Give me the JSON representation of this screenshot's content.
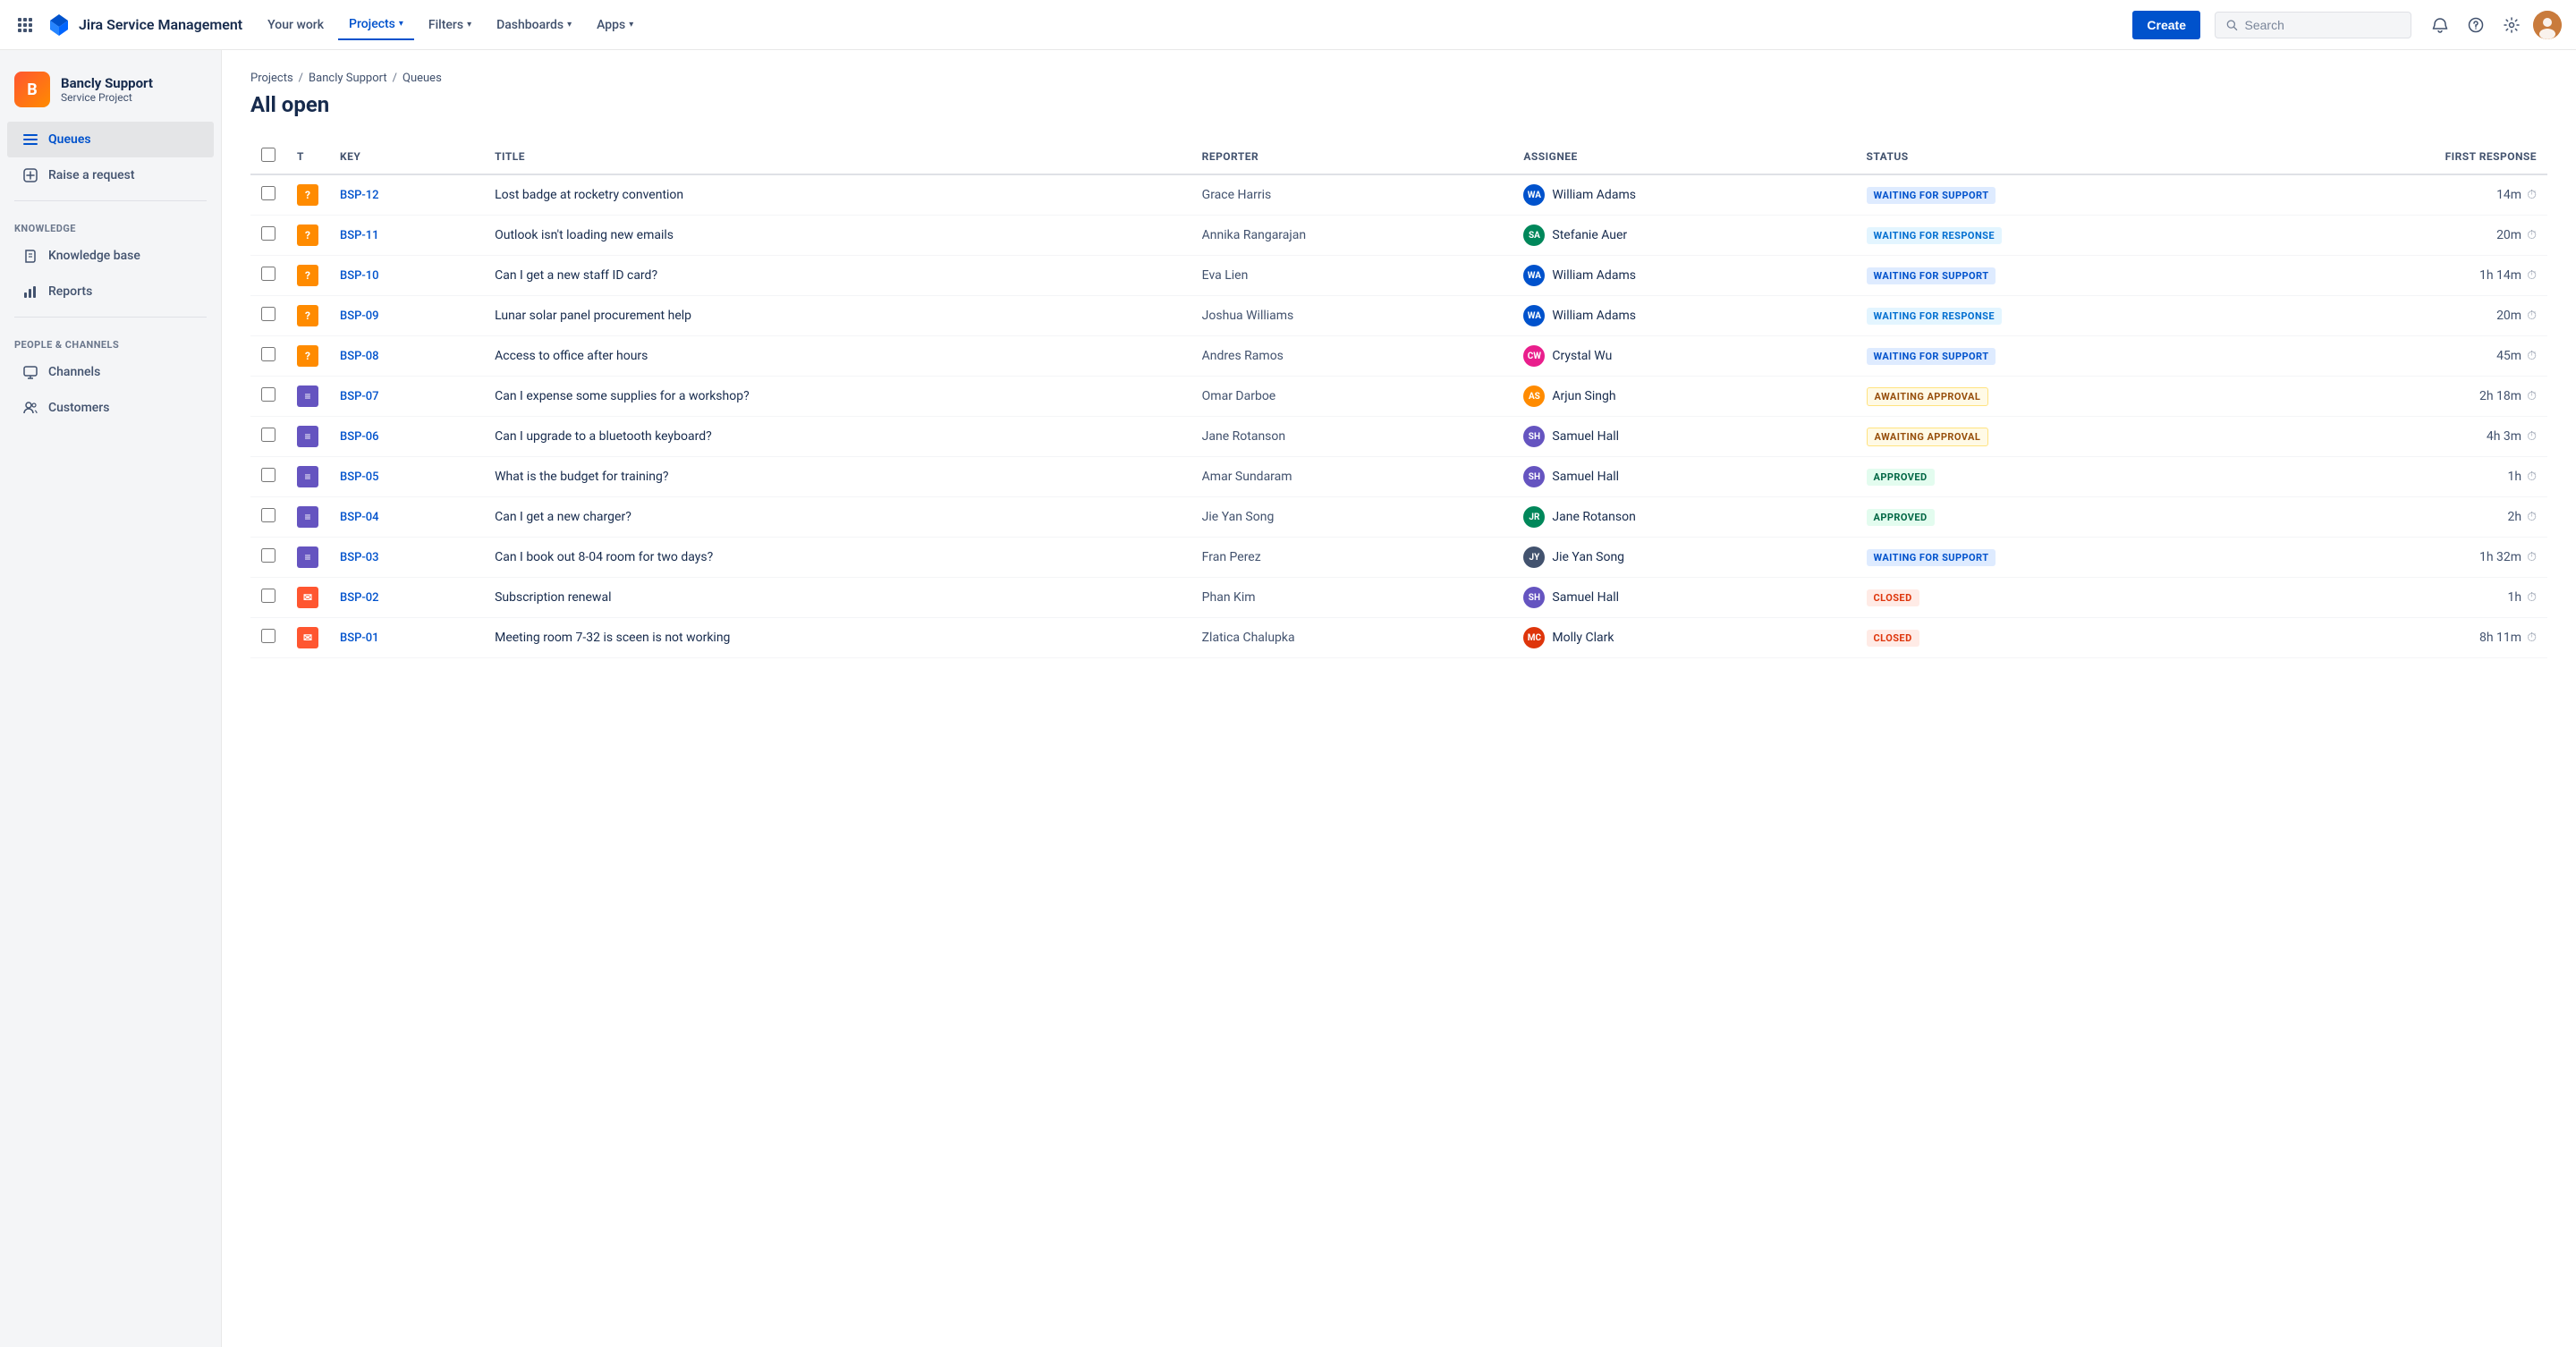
{
  "topnav": {
    "logo_text": "Jira Service Management",
    "nav_items": [
      {
        "label": "Your work",
        "active": false
      },
      {
        "label": "Projects",
        "has_chevron": true,
        "active": true
      },
      {
        "label": "Filters",
        "has_chevron": true,
        "active": false
      },
      {
        "label": "Dashboards",
        "has_chevron": true,
        "active": false
      },
      {
        "label": "Apps",
        "has_chevron": true,
        "active": false
      }
    ],
    "create_label": "Create",
    "search_placeholder": "Search"
  },
  "sidebar": {
    "project_name": "Bancly Support",
    "project_type": "Service Project",
    "main_items": [
      {
        "label": "Queues",
        "active": true,
        "icon": "list"
      },
      {
        "label": "Raise a request",
        "active": false,
        "icon": "plus-circle"
      }
    ],
    "knowledge_label": "KNOWLEDGE",
    "knowledge_items": [
      {
        "label": "Knowledge base",
        "icon": "book"
      },
      {
        "label": "Reports",
        "icon": "bar-chart"
      }
    ],
    "people_label": "PEOPLE & CHANNELS",
    "people_items": [
      {
        "label": "Channels",
        "icon": "monitor"
      },
      {
        "label": "Customers",
        "icon": "users"
      }
    ]
  },
  "breadcrumb": {
    "items": [
      "Projects",
      "Bancly Support",
      "Queues"
    ]
  },
  "page": {
    "title": "All open"
  },
  "table": {
    "columns": [
      "",
      "T",
      "Key",
      "Title",
      "Reporter",
      "Assignee",
      "Status",
      "First response"
    ],
    "rows": [
      {
        "key": "BSP-12",
        "type": "question",
        "title": "Lost badge at rocketry convention",
        "reporter": "Grace Harris",
        "assignee": "William Adams",
        "assignee_initials": "WA",
        "assignee_color": "av-blue",
        "status": "WAITING FOR SUPPORT",
        "status_class": "status-waiting-support",
        "first_response": "14m"
      },
      {
        "key": "BSP-11",
        "type": "question",
        "title": "Outlook isn't loading new emails",
        "reporter": "Annika Rangarajan",
        "assignee": "Stefanie Auer",
        "assignee_initials": "SA",
        "assignee_color": "av-teal",
        "status": "WAITING FOR RESPONSE",
        "status_class": "status-waiting-response",
        "first_response": "20m"
      },
      {
        "key": "BSP-10",
        "type": "question",
        "title": "Can I get a new staff ID card?",
        "reporter": "Eva Lien",
        "assignee": "William Adams",
        "assignee_initials": "WA",
        "assignee_color": "av-blue",
        "status": "WAITING FOR SUPPORT",
        "status_class": "status-waiting-support",
        "first_response": "1h 14m"
      },
      {
        "key": "BSP-09",
        "type": "question",
        "title": "Lunar solar panel procurement help",
        "reporter": "Joshua Williams",
        "assignee": "William Adams",
        "assignee_initials": "WA",
        "assignee_color": "av-blue",
        "status": "WAITING FOR RESPONSE",
        "status_class": "status-waiting-response",
        "first_response": "20m"
      },
      {
        "key": "BSP-08",
        "type": "question",
        "title": "Access to office after hours",
        "reporter": "Andres Ramos",
        "assignee": "Crystal Wu",
        "assignee_initials": "CW",
        "assignee_color": "av-pink",
        "status": "WAITING FOR SUPPORT",
        "status_class": "status-waiting-support",
        "first_response": "45m"
      },
      {
        "key": "BSP-07",
        "type": "change",
        "title": "Can I expense some supplies for a workshop?",
        "reporter": "Omar Darboe",
        "assignee": "Arjun Singh",
        "assignee_initials": "AS",
        "assignee_color": "av-orange",
        "status": "AWAITING APPROVAL",
        "status_class": "status-awaiting-approval",
        "first_response": "2h 18m"
      },
      {
        "key": "BSP-06",
        "type": "change",
        "title": "Can I upgrade to a bluetooth keyboard?",
        "reporter": "Jane Rotanson",
        "assignee": "Samuel Hall",
        "assignee_initials": "SH",
        "assignee_color": "av-purple",
        "status": "AWAITING APPROVAL",
        "status_class": "status-awaiting-approval",
        "first_response": "4h 3m"
      },
      {
        "key": "BSP-05",
        "type": "change",
        "title": "What is the budget for training?",
        "reporter": "Amar Sundaram",
        "assignee": "Samuel Hall",
        "assignee_initials": "SH",
        "assignee_color": "av-purple",
        "status": "APPROVED",
        "status_class": "status-approved",
        "first_response": "1h"
      },
      {
        "key": "BSP-04",
        "type": "change",
        "title": "Can I get a new charger?",
        "reporter": "Jie Yan Song",
        "assignee": "Jane Rotanson",
        "assignee_initials": "JR",
        "assignee_color": "av-teal",
        "status": "APPROVED",
        "status_class": "status-approved",
        "first_response": "2h"
      },
      {
        "key": "BSP-03",
        "type": "change",
        "title": "Can I book out 8-04 room for two days?",
        "reporter": "Fran Perez",
        "assignee": "Jie Yan Song",
        "assignee_initials": "JY",
        "assignee_color": "av-gray",
        "status": "WAITING FOR SUPPORT",
        "status_class": "status-waiting-support",
        "first_response": "1h 32m"
      },
      {
        "key": "BSP-02",
        "type": "email",
        "title": "Subscription renewal",
        "reporter": "Phan Kim",
        "assignee": "Samuel Hall",
        "assignee_initials": "SH",
        "assignee_color": "av-purple",
        "status": "CLOSED",
        "status_class": "status-closed",
        "first_response": "1h"
      },
      {
        "key": "BSP-01",
        "type": "email",
        "title": "Meeting room 7-32 is sceen is not working",
        "reporter": "Zlatica Chalupka",
        "assignee": "Molly Clark",
        "assignee_initials": "MC",
        "assignee_color": "av-red",
        "status": "CLOSED",
        "status_class": "status-closed",
        "first_response": "8h 11m"
      }
    ]
  }
}
